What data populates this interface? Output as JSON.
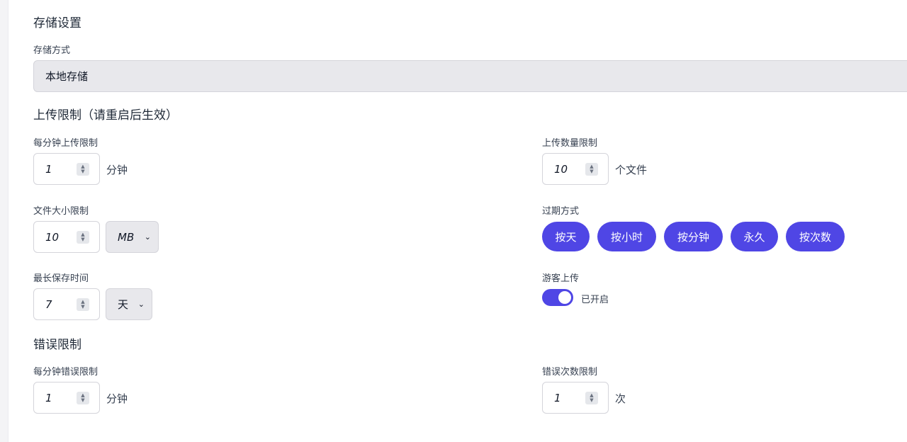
{
  "storage": {
    "section_title": "存储设置",
    "method_label": "存储方式",
    "method_value": "本地存储"
  },
  "upload_limit": {
    "section_title": "上传限制（请重启后生效）",
    "per_minute_label": "每分钟上传限制",
    "per_minute_value": "1",
    "per_minute_unit": "分钟",
    "count_label": "上传数量限制",
    "count_value": "10",
    "count_unit": "个文件",
    "size_label": "文件大小限制",
    "size_value": "10",
    "size_unit": "MB",
    "expire_label": "过期方式",
    "expire_options": [
      "按天",
      "按小时",
      "按分钟",
      "永久",
      "按次数"
    ],
    "retention_label": "最长保存时间",
    "retention_value": "7",
    "retention_unit": "天",
    "guest_label": "游客上传",
    "guest_status": "已开启",
    "guest_enabled": true
  },
  "error_limit": {
    "section_title": "错误限制",
    "per_minute_label": "每分钟错误限制",
    "per_minute_value": "1",
    "per_minute_unit": "分钟",
    "count_label": "错误次数限制",
    "count_value": "1",
    "count_unit": "次"
  },
  "colors": {
    "accent": "#4f46e5",
    "input_bg": "#e8e8ec",
    "border": "#d4d4da"
  }
}
